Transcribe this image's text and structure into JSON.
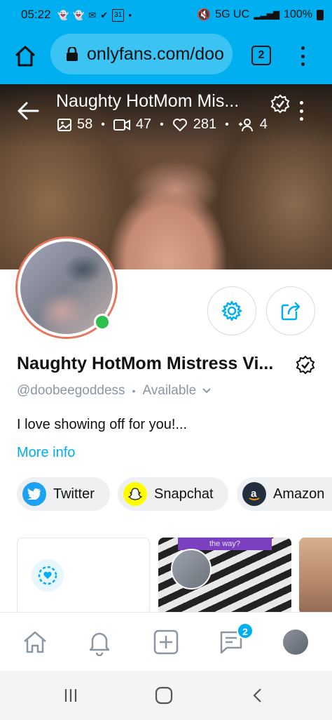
{
  "status_bar": {
    "time": "05:22",
    "network": "5G UC",
    "battery": "100%",
    "notification_icons": [
      "snapchat-icon",
      "snapchat-icon",
      "gmail-icon",
      "messages-icon",
      "calendar-icon",
      "dot-icon"
    ],
    "calendar_date": "31",
    "right_icons": [
      "mute-icon",
      "signal-icon",
      "battery-icon"
    ]
  },
  "browser": {
    "url": "onlyfans.com/doo",
    "tab_count": "2",
    "bar_color": "#00AFF0"
  },
  "cover": {
    "title": "Naughty HotMom Mis...",
    "stats": {
      "photos": "58",
      "videos": "47",
      "likes": "281",
      "subscribers": "4"
    }
  },
  "profile": {
    "name": "Naughty HotMom Mistress Vi...",
    "handle": "@doobeegoddess",
    "status": "Available",
    "bio": "I love showing off for you!...",
    "more_info": "More info",
    "online": true
  },
  "social_links": [
    {
      "label": "Twitter",
      "icon": "twitter-icon",
      "color": "#1DA1F2"
    },
    {
      "label": "Snapchat",
      "icon": "snapchat-icon",
      "color": "#FFFC00"
    },
    {
      "label": "Amazon",
      "icon": "amazon-icon",
      "color": "#232F3E"
    }
  ],
  "media": {
    "thumb_banner": "the way?"
  },
  "bottom_nav": {
    "items": [
      "home-icon",
      "bell-icon",
      "plus-icon",
      "messages-icon",
      "avatar"
    ],
    "messages_badge": "2"
  },
  "system_nav": [
    "recents-icon",
    "home-icon",
    "back-icon"
  ],
  "colors": {
    "accent": "#00AFF0",
    "online": "#2ec04a",
    "avatar_ring": "#e6765f",
    "muted_text": "#8a96a3"
  }
}
